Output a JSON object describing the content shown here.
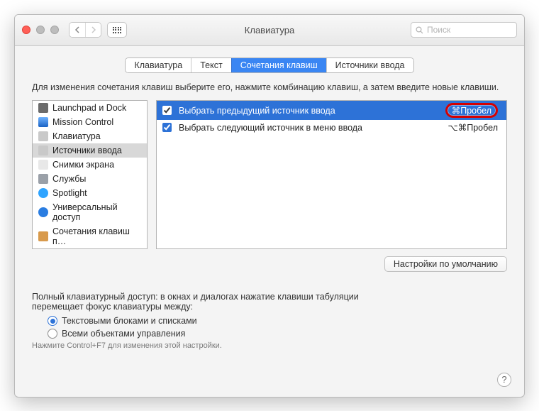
{
  "header": {
    "title": "Клавиатура",
    "search_placeholder": "Поиск"
  },
  "tabs": [
    "Клавиатура",
    "Текст",
    "Сочетания клавиш",
    "Источники ввода"
  ],
  "selected_tab": 2,
  "instructions": "Для изменения сочетания клавиш выберите его, нажмите комбинацию клавиш, а затем введите новые клавиши.",
  "sidebar": {
    "items": [
      {
        "label": "Launchpad и Dock",
        "icon": "launchpad"
      },
      {
        "label": "Mission Control",
        "icon": "mission-control"
      },
      {
        "label": "Клавиатура",
        "icon": "keyboard"
      },
      {
        "label": "Источники ввода",
        "icon": "input-source"
      },
      {
        "label": "Снимки экрана",
        "icon": "screenshot"
      },
      {
        "label": "Службы",
        "icon": "services"
      },
      {
        "label": "Spotlight",
        "icon": "spotlight"
      },
      {
        "label": "Универсальный доступ",
        "icon": "accessibility"
      },
      {
        "label": "Сочетания клавиш п…",
        "icon": "shortcuts"
      }
    ],
    "selected": 3
  },
  "shortcuts": [
    {
      "checked": true,
      "label": "Выбрать предыдущий источник ввода",
      "key": "⌘Пробел",
      "selected": true,
      "highlight": true
    },
    {
      "checked": true,
      "label": "Выбрать следующий источник в меню ввода",
      "key": "⌥⌘Пробел",
      "selected": false,
      "highlight": false
    }
  ],
  "defaults_button": "Настройки по умолчанию",
  "fka": {
    "text_line1": "Полный клавиатурный доступ: в окнах и диалогах нажатие клавиши табуляции",
    "text_line2": "перемещает фокус клавиатуры между:",
    "options": [
      "Текстовыми блоками и списками",
      "Всеми объектами управления"
    ],
    "selected": 0,
    "hint": "Нажмите Control+F7 для изменения этой настройки."
  },
  "help": "?"
}
